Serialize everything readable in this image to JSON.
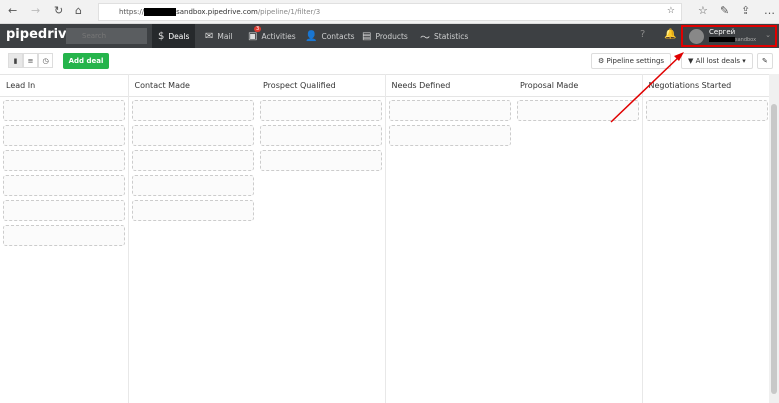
{
  "browser": {
    "url_prefix": "https://",
    "url_host": "sandbox.pipedrive.com",
    "url_path": "/pipeline/1/filter/3"
  },
  "nav": {
    "logo": "pipedrive",
    "search_placeholder": "Search",
    "items": [
      {
        "label": "Deals",
        "icon": "dollar-icon"
      },
      {
        "label": "Mail",
        "icon": "mail-icon"
      },
      {
        "label": "Activities",
        "icon": "calendar-icon",
        "badge": "3"
      },
      {
        "label": "Contacts",
        "icon": "person-icon"
      },
      {
        "label": "Products",
        "icon": "box-icon"
      },
      {
        "label": "Statistics",
        "icon": "chart-icon"
      }
    ],
    "user": {
      "name": "Сергей",
      "company": "sandbox"
    }
  },
  "toolbar": {
    "add_deal": "Add deal",
    "pipeline_settings": "Pipeline settings",
    "filter": "All lost deals"
  },
  "stages": [
    {
      "name": "Lead In",
      "cards": 6
    },
    {
      "name": "Contact Made",
      "cards": 5
    },
    {
      "name": "Prospect Qualified",
      "cards": 3
    },
    {
      "name": "Needs Defined",
      "cards": 2
    },
    {
      "name": "Proposal Made",
      "cards": 1
    },
    {
      "name": "Negotiations Started",
      "cards": 1
    }
  ],
  "colors": {
    "accent": "#25b44b",
    "nav": "#3d4043",
    "highlight": "#e00000"
  }
}
